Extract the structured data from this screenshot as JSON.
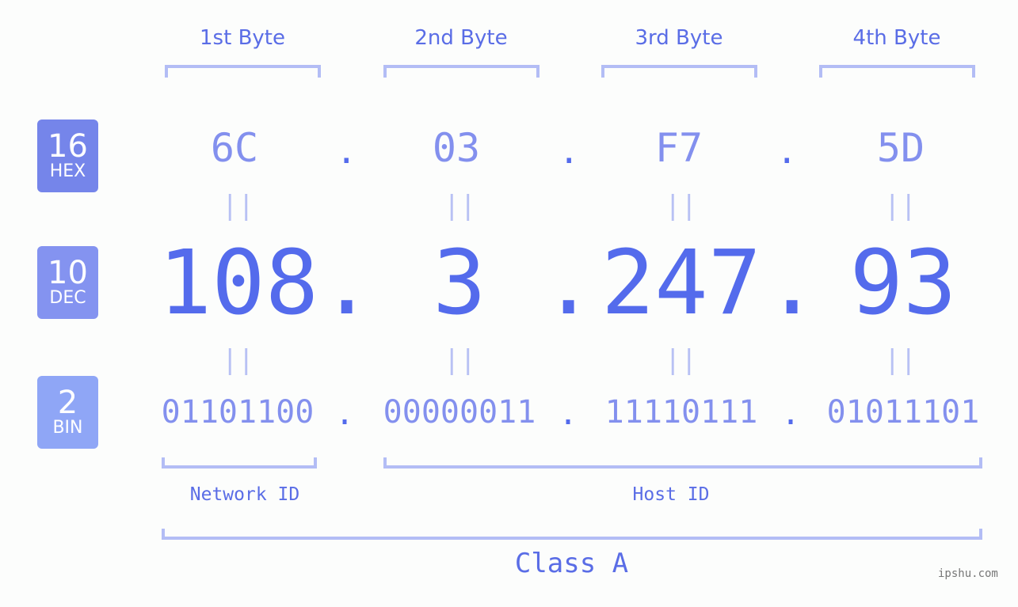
{
  "headers": [
    "1st Byte",
    "2nd Byte",
    "3rd Byte",
    "4th Byte"
  ],
  "badges": [
    {
      "number": "16",
      "label": "HEX",
      "color": "#7585ea"
    },
    {
      "number": "10",
      "label": "DEC",
      "color": "#8493f0"
    },
    {
      "number": "2",
      "label": "BIN",
      "color": "#8fa6f6"
    }
  ],
  "hex": [
    "6C",
    "03",
    "F7",
    "5D"
  ],
  "dec": [
    "108",
    "3",
    "247",
    "93"
  ],
  "bin": [
    "01101100",
    "00000011",
    "11110111",
    "01011101"
  ],
  "separator": ".",
  "equals": "||",
  "network_id_label": "Network ID",
  "host_id_label": "Host ID",
  "class_label": "Class A",
  "watermark": "ipshu.com",
  "colors": {
    "accent": "#546bec",
    "light": "#8390ee",
    "bracket": "#b3bdf5"
  }
}
